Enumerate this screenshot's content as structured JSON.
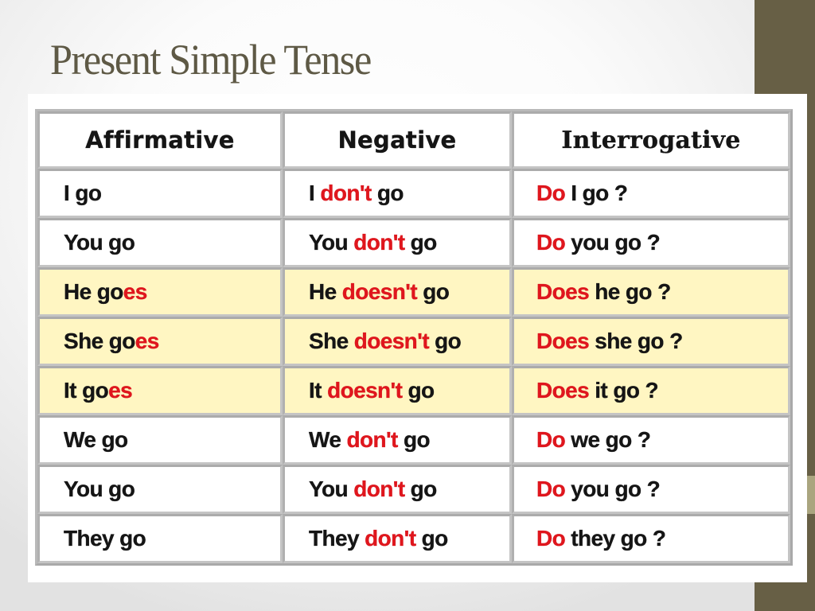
{
  "slide": {
    "title": "Present Simple Tense"
  },
  "colors": {
    "accent_red": "#e0161d",
    "highlight_row": "#fff6c2",
    "sidebar": "#675f45",
    "title_text": "#5e5945"
  },
  "table": {
    "headers": [
      "Affirmative",
      "Negative",
      "Interrogative"
    ],
    "rows": [
      {
        "highlight": false,
        "affirmative": {
          "pre": "I go",
          "red": "",
          "post": ""
        },
        "negative": {
          "pre": "I ",
          "red": "don't",
          "post": " go"
        },
        "interrogative": {
          "pre": "",
          "red": "Do",
          "post": " I go ?"
        }
      },
      {
        "highlight": false,
        "affirmative": {
          "pre": "You go",
          "red": "",
          "post": ""
        },
        "negative": {
          "pre": "You ",
          "red": "don't",
          "post": " go"
        },
        "interrogative": {
          "pre": "",
          "red": "Do",
          "post": " you go ?"
        }
      },
      {
        "highlight": true,
        "affirmative": {
          "pre": "He go",
          "red": "es",
          "post": ""
        },
        "negative": {
          "pre": "He ",
          "red": "doesn't",
          "post": " go"
        },
        "interrogative": {
          "pre": "",
          "red": "Does",
          "post": " he go ?"
        }
      },
      {
        "highlight": true,
        "affirmative": {
          "pre": "She go",
          "red": "es",
          "post": ""
        },
        "negative": {
          "pre": "She ",
          "red": "doesn't",
          "post": " go"
        },
        "interrogative": {
          "pre": "",
          "red": "Does",
          "post": " she go ?"
        }
      },
      {
        "highlight": true,
        "affirmative": {
          "pre": "It go",
          "red": "es",
          "post": ""
        },
        "negative": {
          "pre": "It ",
          "red": "doesn't",
          "post": " go"
        },
        "interrogative": {
          "pre": "",
          "red": "Does",
          "post": " it go ?"
        }
      },
      {
        "highlight": false,
        "affirmative": {
          "pre": "We go",
          "red": "",
          "post": ""
        },
        "negative": {
          "pre": "We ",
          "red": "don't",
          "post": " go"
        },
        "interrogative": {
          "pre": "",
          "red": "Do",
          "post": " we go ?"
        }
      },
      {
        "highlight": false,
        "affirmative": {
          "pre": "You go",
          "red": "",
          "post": ""
        },
        "negative": {
          "pre": "You ",
          "red": "don't",
          "post": " go"
        },
        "interrogative": {
          "pre": "",
          "red": "Do",
          "post": " you go ?"
        }
      },
      {
        "highlight": false,
        "affirmative": {
          "pre": "They go",
          "red": "",
          "post": ""
        },
        "negative": {
          "pre": "They ",
          "red": "don't",
          "post": " go"
        },
        "interrogative": {
          "pre": "",
          "red": "Do",
          "post": " they go ?"
        }
      }
    ]
  }
}
